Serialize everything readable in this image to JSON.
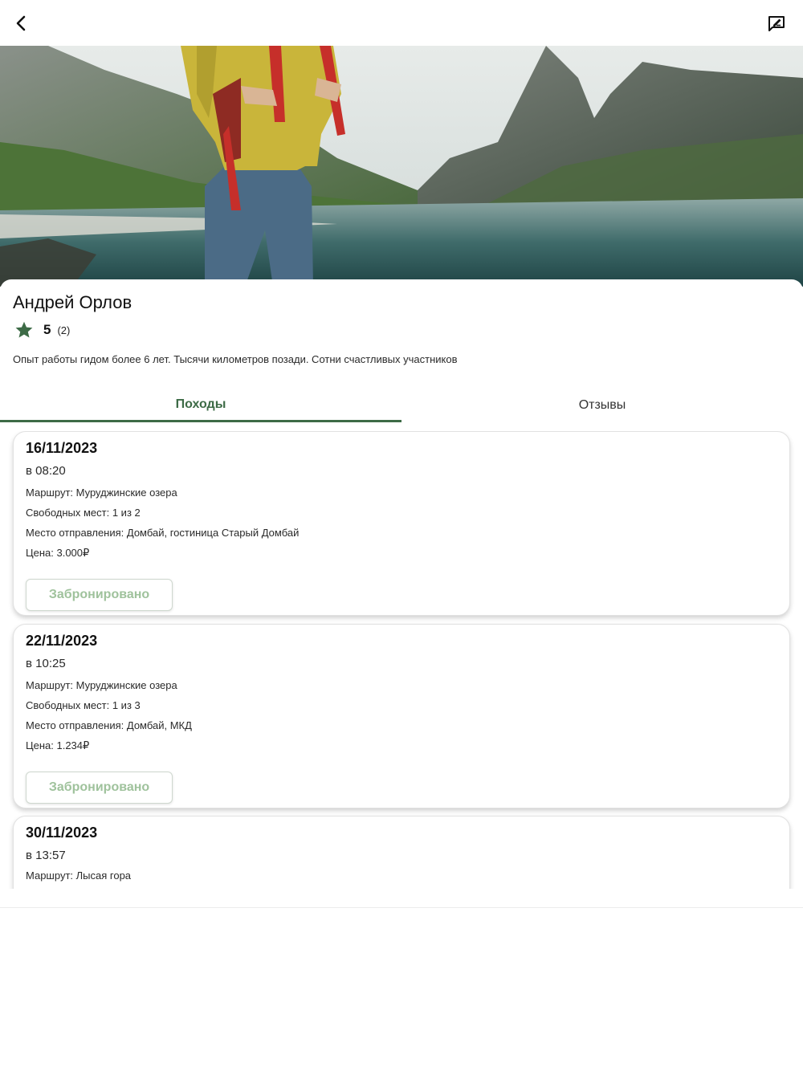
{
  "header": {
    "back_icon": "chevron-left-icon",
    "chat_icon": "message-edit-icon"
  },
  "hero": {
    "image": "hiker-mountain-lake-photo"
  },
  "guide": {
    "name": "Андрей Орлов",
    "rating": "5",
    "reviews_count": "(2)",
    "description": "Опыт работы гидом более 6 лет. Тысячи километров позади. Сотни счастливых участников"
  },
  "tabs": [
    {
      "label": "Походы",
      "active": true
    },
    {
      "label": "Отзывы",
      "active": false
    }
  ],
  "hikes": [
    {
      "date": "16/11/2023",
      "time": "в 08:20",
      "route": "Маршрут: Муруджинские озера",
      "seats": "Свободных мест: 1 из 2",
      "departure": "Место отправления: Домбай, гостиница Старый Домбай",
      "price": "Цена: 3.000₽",
      "button": "Забронировано"
    },
    {
      "date": "22/11/2023",
      "time": "в 10:25",
      "route": "Маршрут: Муруджинские озера",
      "seats": "Свободных мест: 1 из 3",
      "departure": "Место отправления: Домбай, МКД",
      "price": "Цена: 1.234₽",
      "button": "Забронировано"
    },
    {
      "date": "30/11/2023",
      "time": "в 13:57",
      "route": "Маршрут: Лысая гора"
    }
  ],
  "colors": {
    "accent": "#3d6b46",
    "star": "#3d6b46",
    "button_text": "#9fc29c"
  }
}
